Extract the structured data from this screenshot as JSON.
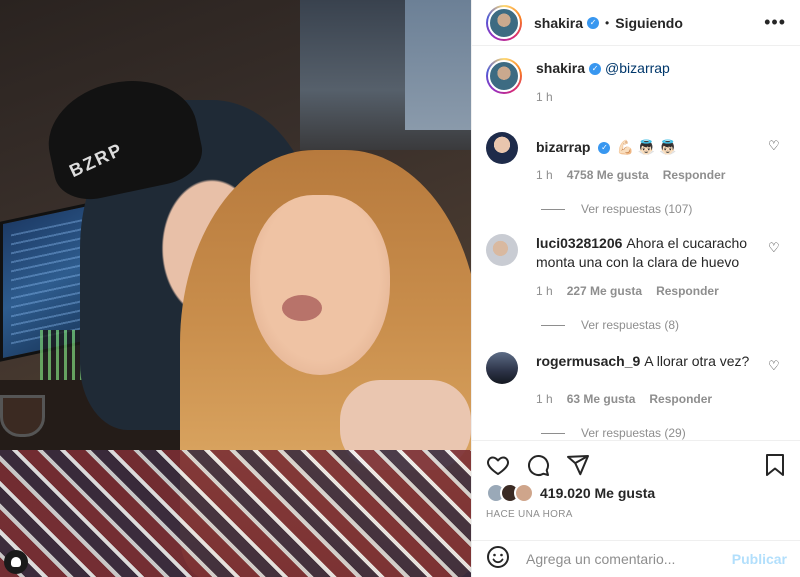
{
  "post": {
    "photo_alt": "",
    "cap_text": "BZRP"
  },
  "header": {
    "username": "shakira",
    "separator": "•",
    "follow_status": "Siguiendo",
    "more_icon": "more-horizontal-icon"
  },
  "caption": {
    "username": "shakira",
    "mention": "@bizarrap",
    "time": "1 h"
  },
  "comments": [
    {
      "username": "bizarrap",
      "text": "💪🏻 👼🏻 👼🏻",
      "time": "1 h",
      "likes": "4758 Me gusta",
      "reply_label": "Responder",
      "replies": "Ver respuestas (107)",
      "verified": true
    },
    {
      "username": "luci03281206",
      "text": "Ahora el cucaracho monta una con la clara de huevo",
      "time": "1 h",
      "likes": "227 Me gusta",
      "reply_label": "Responder",
      "replies": "Ver respuestas (8)"
    },
    {
      "username": "rogermusach_9",
      "text": "A llorar otra vez?",
      "time": "1 h",
      "likes": "63 Me gusta",
      "reply_label": "Responder",
      "replies": "Ver respuestas (29)"
    }
  ],
  "actions": {
    "like_icon": "heart-icon",
    "comment_icon": "comment-icon",
    "share_icon": "share-icon",
    "save_icon": "bookmark-icon"
  },
  "likes": {
    "count": "419.020 Me gusta"
  },
  "timestamp": "HACE UNA HORA",
  "comment_box": {
    "placeholder": "Agrega un comentario...",
    "post_label": "Publicar"
  },
  "colors": {
    "link": "#00376b",
    "verified": "#3897f0",
    "muted": "#8e8e8e",
    "post_disabled": "#b2dffc"
  }
}
